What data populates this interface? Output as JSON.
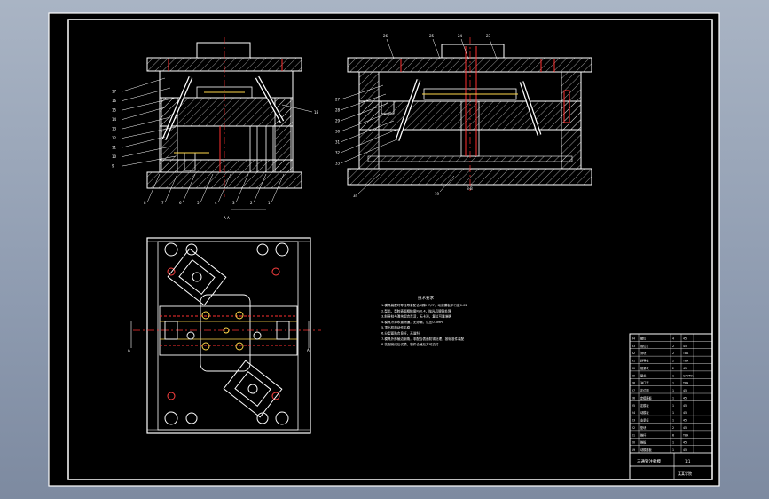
{
  "drawing": {
    "section_a_label": "A-A",
    "section_b_label": "B-B",
    "section_x_marker": "A",
    "tech_req_title": "技术要求",
    "tech_req_lines": [
      "1.模具装配时导柱导套配合间隙H7/f7，动定模板平行度0.02",
      "2.型芯、型腔表面粗糙度Ra0.4，抛光后镀铬处理",
      "3.斜导柱与滑块配合灵活，无卡滞，复位可靠准确",
      "4.模具冷却水道畅通，无渗漏，试压0.5MPa",
      "5.顶出机构动作平稳",
      "6.分型面贴合良好，无溢料",
      "7.模具外形棱边倒角，非配合表面防锈处理，按标准件装配",
      "8.装配完成后试模，制件合格后方可交付"
    ],
    "callouts_left": [
      "17",
      "16",
      "15",
      "14",
      "13",
      "12",
      "11",
      "10",
      "9"
    ],
    "callouts_left_bottom": [
      "8",
      "7",
      "6",
      "5",
      "4",
      "3",
      "2",
      "1"
    ],
    "callouts_left_right": [
      "18"
    ],
    "callouts_right_top": [
      "26",
      "25",
      "24",
      "23"
    ],
    "callouts_right_left": [
      "27",
      "28",
      "29",
      "30",
      "31",
      "32",
      "33"
    ],
    "callouts_right_bottom": [
      "34",
      "19"
    ],
    "title_block": {
      "drawing_name": "三通管注射模",
      "school": "某某学院",
      "scale_text": "1:1",
      "rows": [
        [
          "34",
          "螺钉",
          "4",
          "45"
        ],
        [
          "33",
          "限位钉",
          "2",
          "45"
        ],
        [
          "32",
          "滑块",
          "2",
          "T8A"
        ],
        [
          "31",
          "斜导柱",
          "2",
          "T8A"
        ],
        [
          "30",
          "楔紧块",
          "2",
          "45"
        ],
        [
          "29",
          "型芯",
          "1",
          "CrWMn"
        ],
        [
          "28",
          "浇口套",
          "1",
          "T8A"
        ],
        [
          "27",
          "定位圈",
          "1",
          "45"
        ],
        [
          "26",
          "定模座板",
          "1",
          "45"
        ],
        [
          "25",
          "定模板",
          "1",
          "45"
        ],
        [
          "24",
          "动模板",
          "1",
          "45"
        ],
        [
          "23",
          "支承板",
          "1",
          "45"
        ],
        [
          "22",
          "垫块",
          "2",
          "45"
        ],
        [
          "21",
          "推杆",
          "6",
          "T8A"
        ],
        [
          "20",
          "推板",
          "1",
          "45"
        ],
        [
          "19",
          "动模座板",
          "1",
          "45"
        ]
      ]
    }
  }
}
